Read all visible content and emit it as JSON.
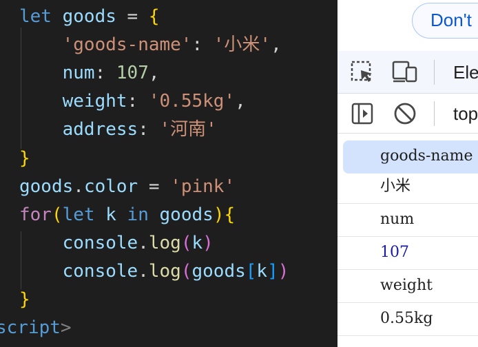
{
  "editor": {
    "lines": [
      [
        [
          "kw",
          "let "
        ],
        [
          "var",
          "goods"
        ],
        [
          "op",
          " = "
        ],
        [
          "b1",
          "{"
        ]
      ],
      [
        [
          "op",
          "    "
        ],
        [
          "str",
          "'goods-name'"
        ],
        [
          "op",
          ": "
        ],
        [
          "str",
          "'小米'"
        ],
        [
          "op",
          ","
        ]
      ],
      [
        [
          "op",
          "    "
        ],
        [
          "var",
          "num"
        ],
        [
          "op",
          ": "
        ],
        [
          "num",
          "107"
        ],
        [
          "op",
          ","
        ]
      ],
      [
        [
          "op",
          "    "
        ],
        [
          "var",
          "weight"
        ],
        [
          "op",
          ": "
        ],
        [
          "str",
          "'0.55kg'"
        ],
        [
          "op",
          ","
        ]
      ],
      [
        [
          "op",
          "    "
        ],
        [
          "var",
          "address"
        ],
        [
          "op",
          ": "
        ],
        [
          "str",
          "'河南'"
        ]
      ],
      [
        [
          "b1",
          "}"
        ]
      ],
      [
        [
          "var",
          "goods"
        ],
        [
          "op",
          "."
        ],
        [
          "var",
          "color"
        ],
        [
          "op",
          " = "
        ],
        [
          "str",
          "'pink'"
        ]
      ],
      [
        [
          "kw2",
          "for"
        ],
        [
          "b1",
          "("
        ],
        [
          "kw",
          "let "
        ],
        [
          "var",
          "k"
        ],
        [
          "kw",
          " in "
        ],
        [
          "var",
          "goods"
        ],
        [
          "b1",
          ")"
        ],
        [
          "b1",
          "{"
        ]
      ],
      [
        [
          "op",
          "    "
        ],
        [
          "var",
          "console"
        ],
        [
          "op",
          "."
        ],
        [
          "fn",
          "log"
        ],
        [
          "b2",
          "("
        ],
        [
          "var",
          "k"
        ],
        [
          "b2",
          ")"
        ]
      ],
      [
        [
          "op",
          "    "
        ],
        [
          "var",
          "console"
        ],
        [
          "op",
          "."
        ],
        [
          "fn",
          "log"
        ],
        [
          "b2",
          "("
        ],
        [
          "var",
          "goods"
        ],
        [
          "b3",
          "["
        ],
        [
          "var",
          "k"
        ],
        [
          "b3",
          "]"
        ],
        [
          "b2",
          ")"
        ]
      ],
      [
        [
          "b1",
          "}"
        ]
      ],
      [
        [
          "tagn",
          "script"
        ],
        [
          "tagp",
          ">"
        ]
      ]
    ]
  },
  "devtools": {
    "banner_button": "Don't",
    "tab_elements": "Ele",
    "context": "top",
    "console_rows": [
      {
        "text": "goods-name",
        "selected": true,
        "kind": "str"
      },
      {
        "text": "小米",
        "selected": false,
        "kind": "str"
      },
      {
        "text": "num",
        "selected": false,
        "kind": "str"
      },
      {
        "text": "107",
        "selected": false,
        "kind": "num"
      },
      {
        "text": "weight",
        "selected": false,
        "kind": "str"
      },
      {
        "text": "0.55kg",
        "selected": false,
        "kind": "str"
      }
    ]
  },
  "colors": {
    "editor_bg": "#1e1e1e",
    "keyword": "#569cd6",
    "string": "#ce9178",
    "variable": "#9cdcfe",
    "number": "#b5cea8",
    "function": "#dcdcaa",
    "bracket_gold": "#ffd700",
    "devtools_accent": "#0b57d0"
  }
}
